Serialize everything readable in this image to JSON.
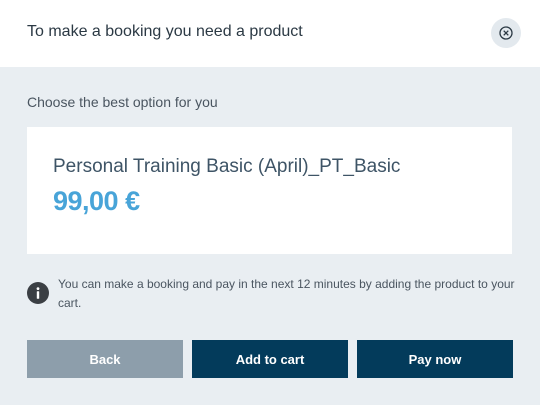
{
  "header": {
    "title": "To make a booking you need a product",
    "close_icon": "close-circle-icon"
  },
  "section": {
    "label": "Choose the best option for you"
  },
  "product": {
    "name": "Personal Training Basic (April)_PT_Basic",
    "price": "99,00 €"
  },
  "info": {
    "icon": "info-icon",
    "text": "You can make a booking and pay in the next 12 minutes by adding the product to your cart."
  },
  "actions": {
    "back_label": "Back",
    "add_to_cart_label": "Add to cart",
    "pay_now_label": "Pay now"
  },
  "colors": {
    "header_bg": "#ffffff",
    "body_bg": "#e9eef2",
    "price": "#48a4d8",
    "primary_button": "#033b5b",
    "secondary_button": "#8d9eab"
  }
}
